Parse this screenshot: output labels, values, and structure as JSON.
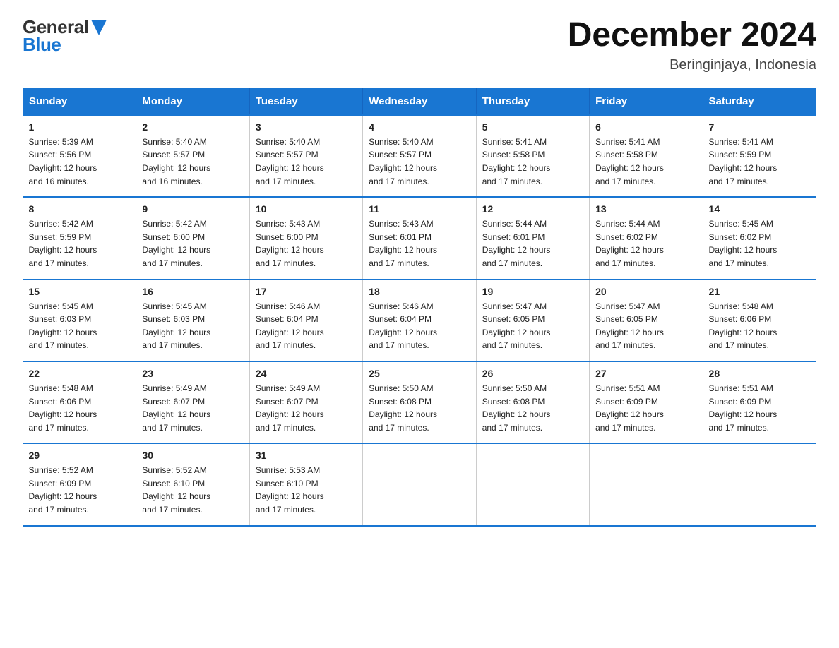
{
  "header": {
    "logo_general": "General",
    "logo_blue": "Blue",
    "month_title": "December 2024",
    "location": "Beringinjaya, Indonesia"
  },
  "days_of_week": [
    "Sunday",
    "Monday",
    "Tuesday",
    "Wednesday",
    "Thursday",
    "Friday",
    "Saturday"
  ],
  "weeks": [
    [
      {
        "day": "1",
        "sunrise": "5:39 AM",
        "sunset": "5:56 PM",
        "daylight": "12 hours and 16 minutes."
      },
      {
        "day": "2",
        "sunrise": "5:40 AM",
        "sunset": "5:57 PM",
        "daylight": "12 hours and 16 minutes."
      },
      {
        "day": "3",
        "sunrise": "5:40 AM",
        "sunset": "5:57 PM",
        "daylight": "12 hours and 17 minutes."
      },
      {
        "day": "4",
        "sunrise": "5:40 AM",
        "sunset": "5:57 PM",
        "daylight": "12 hours and 17 minutes."
      },
      {
        "day": "5",
        "sunrise": "5:41 AM",
        "sunset": "5:58 PM",
        "daylight": "12 hours and 17 minutes."
      },
      {
        "day": "6",
        "sunrise": "5:41 AM",
        "sunset": "5:58 PM",
        "daylight": "12 hours and 17 minutes."
      },
      {
        "day": "7",
        "sunrise": "5:41 AM",
        "sunset": "5:59 PM",
        "daylight": "12 hours and 17 minutes."
      }
    ],
    [
      {
        "day": "8",
        "sunrise": "5:42 AM",
        "sunset": "5:59 PM",
        "daylight": "12 hours and 17 minutes."
      },
      {
        "day": "9",
        "sunrise": "5:42 AM",
        "sunset": "6:00 PM",
        "daylight": "12 hours and 17 minutes."
      },
      {
        "day": "10",
        "sunrise": "5:43 AM",
        "sunset": "6:00 PM",
        "daylight": "12 hours and 17 minutes."
      },
      {
        "day": "11",
        "sunrise": "5:43 AM",
        "sunset": "6:01 PM",
        "daylight": "12 hours and 17 minutes."
      },
      {
        "day": "12",
        "sunrise": "5:44 AM",
        "sunset": "6:01 PM",
        "daylight": "12 hours and 17 minutes."
      },
      {
        "day": "13",
        "sunrise": "5:44 AM",
        "sunset": "6:02 PM",
        "daylight": "12 hours and 17 minutes."
      },
      {
        "day": "14",
        "sunrise": "5:45 AM",
        "sunset": "6:02 PM",
        "daylight": "12 hours and 17 minutes."
      }
    ],
    [
      {
        "day": "15",
        "sunrise": "5:45 AM",
        "sunset": "6:03 PM",
        "daylight": "12 hours and 17 minutes."
      },
      {
        "day": "16",
        "sunrise": "5:45 AM",
        "sunset": "6:03 PM",
        "daylight": "12 hours and 17 minutes."
      },
      {
        "day": "17",
        "sunrise": "5:46 AM",
        "sunset": "6:04 PM",
        "daylight": "12 hours and 17 minutes."
      },
      {
        "day": "18",
        "sunrise": "5:46 AM",
        "sunset": "6:04 PM",
        "daylight": "12 hours and 17 minutes."
      },
      {
        "day": "19",
        "sunrise": "5:47 AM",
        "sunset": "6:05 PM",
        "daylight": "12 hours and 17 minutes."
      },
      {
        "day": "20",
        "sunrise": "5:47 AM",
        "sunset": "6:05 PM",
        "daylight": "12 hours and 17 minutes."
      },
      {
        "day": "21",
        "sunrise": "5:48 AM",
        "sunset": "6:06 PM",
        "daylight": "12 hours and 17 minutes."
      }
    ],
    [
      {
        "day": "22",
        "sunrise": "5:48 AM",
        "sunset": "6:06 PM",
        "daylight": "12 hours and 17 minutes."
      },
      {
        "day": "23",
        "sunrise": "5:49 AM",
        "sunset": "6:07 PM",
        "daylight": "12 hours and 17 minutes."
      },
      {
        "day": "24",
        "sunrise": "5:49 AM",
        "sunset": "6:07 PM",
        "daylight": "12 hours and 17 minutes."
      },
      {
        "day": "25",
        "sunrise": "5:50 AM",
        "sunset": "6:08 PM",
        "daylight": "12 hours and 17 minutes."
      },
      {
        "day": "26",
        "sunrise": "5:50 AM",
        "sunset": "6:08 PM",
        "daylight": "12 hours and 17 minutes."
      },
      {
        "day": "27",
        "sunrise": "5:51 AM",
        "sunset": "6:09 PM",
        "daylight": "12 hours and 17 minutes."
      },
      {
        "day": "28",
        "sunrise": "5:51 AM",
        "sunset": "6:09 PM",
        "daylight": "12 hours and 17 minutes."
      }
    ],
    [
      {
        "day": "29",
        "sunrise": "5:52 AM",
        "sunset": "6:09 PM",
        "daylight": "12 hours and 17 minutes."
      },
      {
        "day": "30",
        "sunrise": "5:52 AM",
        "sunset": "6:10 PM",
        "daylight": "12 hours and 17 minutes."
      },
      {
        "day": "31",
        "sunrise": "5:53 AM",
        "sunset": "6:10 PM",
        "daylight": "12 hours and 17 minutes."
      },
      null,
      null,
      null,
      null
    ]
  ]
}
